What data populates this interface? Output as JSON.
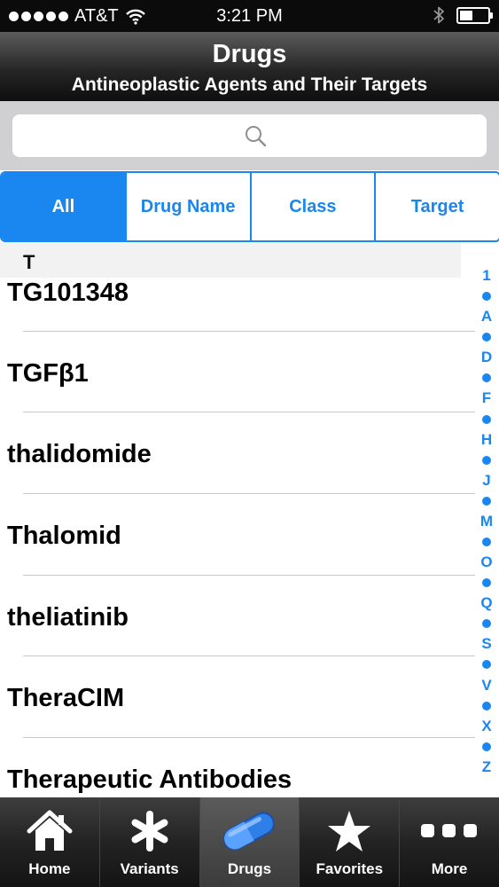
{
  "status": {
    "carrier": "AT&T",
    "time": "3:21 PM"
  },
  "nav": {
    "title": "Drugs",
    "subtitle": "Antineoplastic Agents and Their Targets"
  },
  "search": {
    "placeholder": ""
  },
  "segments": [
    "All",
    "Drug Name",
    "Class",
    "Target"
  ],
  "section": {
    "letter": "T"
  },
  "items": [
    "TG101348",
    "TGFβ1",
    "thalidomide",
    "Thalomid",
    "theliatinib",
    "TheraCIM",
    "Therapeutic Antibodies"
  ],
  "index": [
    "1",
    "•",
    "A",
    "•",
    "D",
    "•",
    "F",
    "•",
    "H",
    "•",
    "J",
    "•",
    "M",
    "•",
    "O",
    "•",
    "Q",
    "•",
    "S",
    "•",
    "V",
    "•",
    "X",
    "•",
    "Z"
  ],
  "tabs": [
    "Home",
    "Variants",
    "Drugs",
    "Favorites",
    "More"
  ],
  "colors": {
    "accent": "#1a86f0"
  }
}
